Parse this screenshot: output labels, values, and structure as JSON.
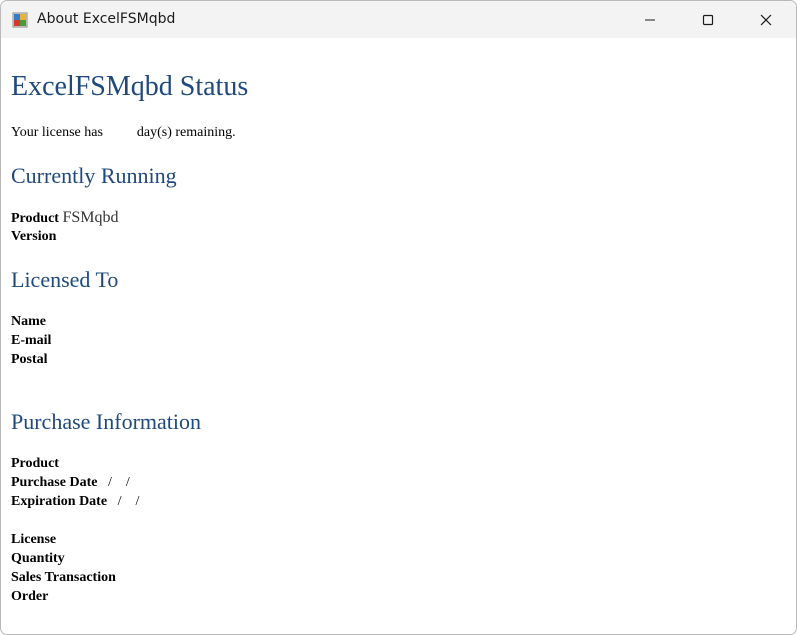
{
  "window": {
    "title": "About ExcelFSMqbd",
    "icon": "app-icon",
    "controls": [
      "minimize-icon",
      "maximize-icon",
      "close-icon"
    ]
  },
  "heading": "ExcelFSMqbd Status",
  "license_text_before": "Your license has",
  "license_days": "",
  "license_text_after": "day(s) remaining.",
  "currently_running": {
    "heading": "Currently Running",
    "product_label": "Product",
    "product_value": "FSMqbd",
    "version_label": "Version",
    "version_value": ""
  },
  "licensed_to": {
    "heading": "Licensed To",
    "name_label": "Name",
    "email_label": "E-mail",
    "postal_label": "Postal"
  },
  "purchase": {
    "heading": "Purchase Information",
    "product_label": "Product",
    "purchase_date_label": "Purchase Date",
    "purchase_date_value": "/    /",
    "expiration_date_label": "Expiration Date",
    "expiration_date_value": "/    /",
    "license_label": "License",
    "quantity_label": "Quantity",
    "sales_transaction_label": "Sales Transaction",
    "order_label": "Order"
  }
}
